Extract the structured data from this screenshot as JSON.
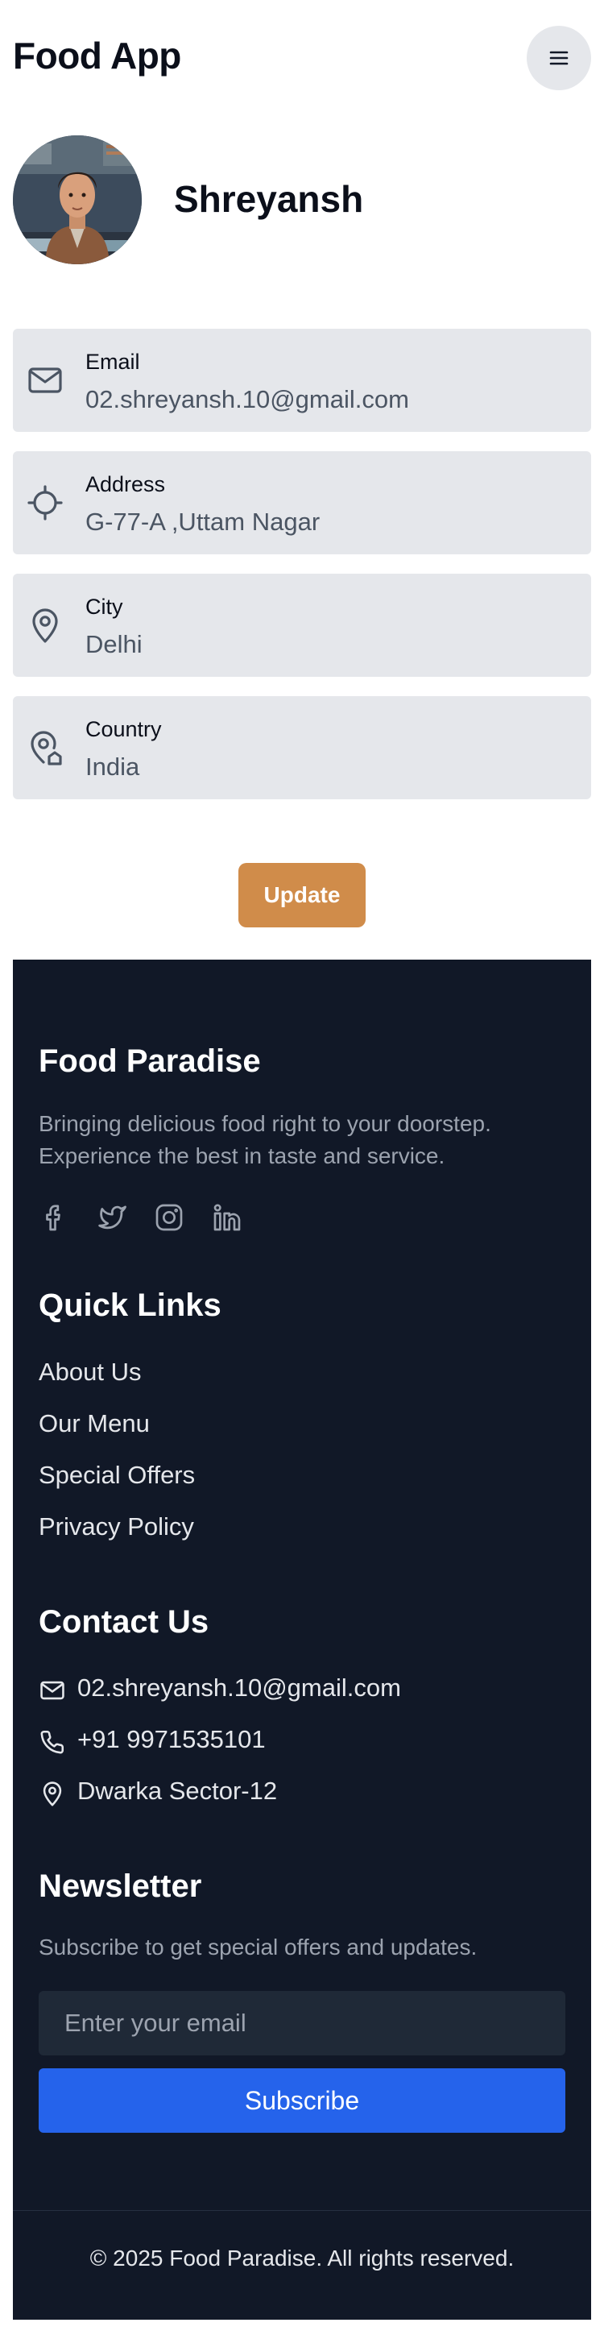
{
  "header": {
    "title": "Food App",
    "menu_icon": "hamburger-menu-icon"
  },
  "profile": {
    "name": "Shreyansh",
    "avatar": "user-avatar-illustration"
  },
  "info_fields": [
    {
      "icon": "mail-icon",
      "label": "Email",
      "value": "02.shreyansh.10@gmail.com"
    },
    {
      "icon": "crosshair-icon",
      "label": "Address",
      "value": "G-77-A ,Uttam Nagar"
    },
    {
      "icon": "map-pin-icon",
      "label": "City",
      "value": "Delhi"
    },
    {
      "icon": "map-pin-house-icon",
      "label": "Country",
      "value": "India"
    }
  ],
  "update_button": {
    "label": "Update",
    "color": "#d08c4a"
  },
  "footer": {
    "background": "#111827",
    "brand": {
      "title": "Food Paradise",
      "description": "Bringing delicious food right to your doorstep. Experience the best in taste and service.",
      "social": [
        "facebook-icon",
        "twitter-icon",
        "instagram-icon",
        "linkedin-icon"
      ]
    },
    "quick_links": {
      "title": "Quick Links",
      "items": [
        "About Us",
        "Our Menu",
        "Special Offers",
        "Privacy Policy"
      ]
    },
    "contact": {
      "title": "Contact Us",
      "email": "02.shreyansh.10@gmail.com",
      "phone": "+91 9971535101",
      "address": "Dwarka Sector-12"
    },
    "newsletter": {
      "title": "Newsletter",
      "description": "Subscribe to get special offers and updates.",
      "placeholder": "Enter your email",
      "button_label": "Subscribe",
      "button_color": "#2563eb"
    },
    "copyright": "© 2025 Food Paradise. All rights reserved."
  }
}
